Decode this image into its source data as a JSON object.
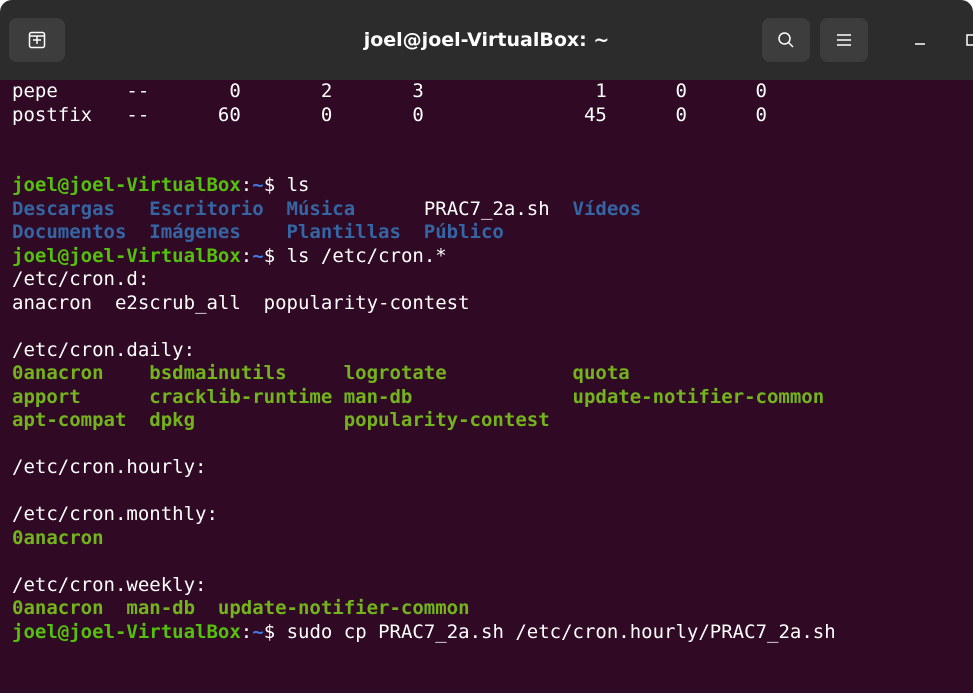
{
  "window": {
    "title": "joel@joel-VirtualBox: ~"
  },
  "icons": {
    "new_tab": "new-tab-icon",
    "search": "search-icon",
    "menu": "hamburger-menu-icon",
    "minimize": "minimize-icon",
    "maximize": "maximize-icon"
  },
  "colors": {
    "titlebar": "#2c2c2c",
    "terminal_bg": "#300a24",
    "prompt_user": "#55c00e",
    "prompt_path": "#3f7ae2",
    "dir_blue": "#3465a4",
    "exec_green": "#73b41d"
  },
  "terminal": {
    "lines": [
      [
        {
          "t": "pepe      --       0       2       3               1      0      0",
          "c": "white"
        }
      ],
      [
        {
          "t": "postfix   --      60       0       0              45      0      0",
          "c": "white"
        }
      ],
      [
        {
          "t": "",
          "c": "white"
        }
      ],
      [
        {
          "t": "",
          "c": "white"
        }
      ],
      [
        {
          "t": "joel@joel-VirtualBox",
          "c": "prompt-user"
        },
        {
          "t": ":",
          "c": "white"
        },
        {
          "t": "~",
          "c": "prompt-path"
        },
        {
          "t": "$ ls",
          "c": "white"
        }
      ],
      [
        {
          "t": "Descargas   Escritorio  Música      ",
          "c": "blue"
        },
        {
          "t": "PRAC7_2a.sh  ",
          "c": "white"
        },
        {
          "t": "Vídeos",
          "c": "blue"
        }
      ],
      [
        {
          "t": "Documentos  Imágenes    Plantillas  Público",
          "c": "blue"
        }
      ],
      [
        {
          "t": "joel@joel-VirtualBox",
          "c": "prompt-user"
        },
        {
          "t": ":",
          "c": "white"
        },
        {
          "t": "~",
          "c": "prompt-path"
        },
        {
          "t": "$ ls /etc/cron.*",
          "c": "white"
        }
      ],
      [
        {
          "t": "/etc/cron.d:",
          "c": "white"
        }
      ],
      [
        {
          "t": "anacron  e2scrub_all  popularity-contest",
          "c": "white"
        }
      ],
      [
        {
          "t": "",
          "c": "white"
        }
      ],
      [
        {
          "t": "/etc/cron.daily:",
          "c": "white"
        }
      ],
      [
        {
          "t": "0anacron    bsdmainutils     logrotate           quota",
          "c": "yellow-green"
        }
      ],
      [
        {
          "t": "apport      cracklib-runtime man-db              update-notifier-common",
          "c": "yellow-green"
        }
      ],
      [
        {
          "t": "apt-compat  dpkg             popularity-contest",
          "c": "yellow-green"
        }
      ],
      [
        {
          "t": "",
          "c": "white"
        }
      ],
      [
        {
          "t": "/etc/cron.hourly:",
          "c": "white"
        }
      ],
      [
        {
          "t": "",
          "c": "white"
        }
      ],
      [
        {
          "t": "/etc/cron.monthly:",
          "c": "white"
        }
      ],
      [
        {
          "t": "0anacron",
          "c": "yellow-green"
        }
      ],
      [
        {
          "t": "",
          "c": "white"
        }
      ],
      [
        {
          "t": "/etc/cron.weekly:",
          "c": "white"
        }
      ],
      [
        {
          "t": "0anacron  man-db  update-notifier-common",
          "c": "yellow-green"
        }
      ],
      [
        {
          "t": "joel@joel-VirtualBox",
          "c": "prompt-user"
        },
        {
          "t": ":",
          "c": "white"
        },
        {
          "t": "~",
          "c": "prompt-path"
        },
        {
          "t": "$ sudo cp PRAC7_2a.sh /etc/cron.hourly/PRAC7_2a.sh",
          "c": "white"
        }
      ]
    ]
  }
}
